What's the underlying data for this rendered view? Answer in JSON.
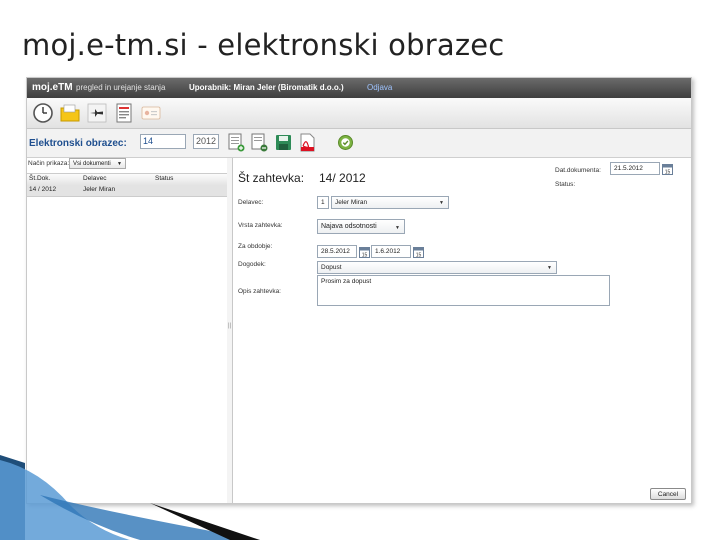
{
  "slide": {
    "title": "moj.e-tm.si  - elektronski obrazec"
  },
  "app": {
    "logo": "moj.eTM",
    "description": "pregled in urejanje stanja",
    "user_label": "Uporabnik: Miran Jeler  (Biromatik d.o.o.)",
    "logout": "Odjava",
    "toolbar_icons": [
      "clock-icon",
      "folder-icon",
      "plane-icon",
      "document-list-icon",
      "card-icon"
    ]
  },
  "form_header": {
    "title": "Elektronski obrazec:",
    "number": "14",
    "year": "2012",
    "action_icons": [
      "add-document-icon",
      "edit-document-icon",
      "save-icon",
      "pdf-icon",
      "confirm-icon"
    ]
  },
  "left_panel": {
    "filter_label": "Način prikaza:",
    "filter_value": "Vsi dokumenti",
    "columns": [
      "Št.Dok.",
      "Delavec",
      "Status"
    ],
    "rows": [
      [
        "14 / 2012",
        "Jeler Miran",
        ""
      ]
    ]
  },
  "request": {
    "title": "Št zahtevka:",
    "number": "14/ 2012",
    "doc_date_label": "Dat.dokumenta:",
    "doc_date": "21.5.2012",
    "status_label": "Status:",
    "worker_label": "Delavec:",
    "worker_id": "1",
    "worker_name": "Jeler Miran",
    "type_label": "Vrsta zahtevka:",
    "type_value": "Najava odsotnosti",
    "period_label": "Za obdobje:",
    "period_from": "28.5.2012",
    "period_to": "1.6.2012",
    "event_label": "Dogodek:",
    "event_value": "Dopust",
    "desc_label": "Opis zahtevka:",
    "desc_value": "Prosim za dopust",
    "cancel": "Cancel"
  },
  "colors": {
    "accent": "#1f4f8f",
    "appbar": "#4a4a4a"
  }
}
